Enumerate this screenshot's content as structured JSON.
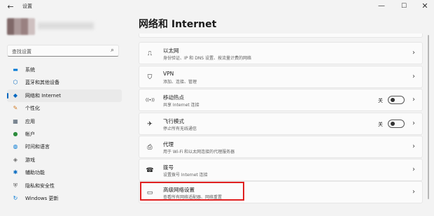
{
  "window": {
    "back_glyph": "←",
    "title": "设置",
    "minimize_glyph": "—",
    "maximize_glyph": "☐",
    "close_glyph": "✕"
  },
  "search": {
    "placeholder": "查找设置",
    "icon": "search-icon"
  },
  "sidebar": {
    "items": [
      {
        "label": "系统",
        "icon": "monitor-icon",
        "icon_glyph": "▬",
        "icon_color": "#0078d4"
      },
      {
        "label": "蓝牙和其他设备",
        "icon": "bluetooth-icon",
        "icon_glyph": "⬡",
        "icon_color": "#0067c0"
      },
      {
        "label": "网络和 Internet",
        "icon": "wifi-icon",
        "icon_glyph": "◆",
        "icon_color": "#0067c0",
        "active": true
      },
      {
        "label": "个性化",
        "icon": "brush-icon",
        "icon_glyph": "✎",
        "icon_color": "#d17a22"
      },
      {
        "label": "应用",
        "icon": "apps-icon",
        "icon_glyph": "▦",
        "icon_color": "#4a5a6a"
      },
      {
        "label": "帐户",
        "icon": "account-icon",
        "icon_glyph": "●",
        "icon_color": "#2c8c3c"
      },
      {
        "label": "时间和语言",
        "icon": "globe-clock-icon",
        "icon_glyph": "◍",
        "icon_color": "#0078d4"
      },
      {
        "label": "游戏",
        "icon": "gamepad-icon",
        "icon_glyph": "◈",
        "icon_color": "#6b6b6b"
      },
      {
        "label": "辅助功能",
        "icon": "accessibility-icon",
        "icon_glyph": "✱",
        "icon_color": "#0067c0"
      },
      {
        "label": "隐私和安全性",
        "icon": "shield-icon",
        "icon_glyph": "⛨",
        "icon_color": "#5a5a5a"
      },
      {
        "label": "Windows 更新",
        "icon": "update-icon",
        "icon_glyph": "↻",
        "icon_color": "#0078d4"
      }
    ]
  },
  "main": {
    "title": "网络和 Internet",
    "cards": [
      {
        "title": "以太网",
        "subtitle": "身份验证、IP 和 DNS 设置、按流量计费的网络",
        "icon": "ethernet-icon",
        "icon_glyph": "⎍"
      },
      {
        "title": "VPN",
        "subtitle": "添加、连接、管理",
        "icon": "vpn-shield-icon",
        "icon_glyph": "⛉"
      },
      {
        "title": "移动热点",
        "subtitle": "共享 Internet 连接",
        "icon": "hotspot-icon",
        "icon_glyph": "((•))",
        "toggle_label": "关"
      },
      {
        "title": "飞行模式",
        "subtitle": "停止所有无线通信",
        "icon": "airplane-icon",
        "icon_glyph": "✈",
        "toggle_label": "关"
      },
      {
        "title": "代理",
        "subtitle": "用于 Wi-Fi 和以太网连接的代理服务器",
        "icon": "proxy-icon",
        "icon_glyph": "⎙"
      },
      {
        "title": "拨号",
        "subtitle": "设置拨号 Internet 连接",
        "icon": "dialup-icon",
        "icon_glyph": "☎"
      },
      {
        "title": "高级网络设置",
        "subtitle": "查看所有网络适配器、网络重置",
        "icon": "advanced-network-icon",
        "icon_glyph": "▭"
      }
    ],
    "chevron_glyph": "›",
    "highlight_color": "#e02020"
  }
}
